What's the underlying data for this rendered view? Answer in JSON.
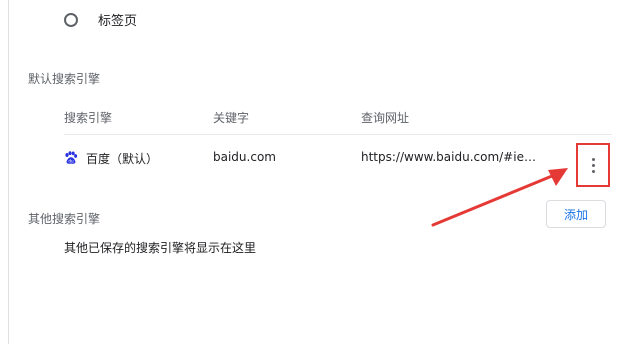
{
  "startup": {
    "radio_label": "标签页"
  },
  "default_engines": {
    "title": "默认搜索引擎",
    "headers": {
      "engine": "搜索引擎",
      "keyword": "关键字",
      "url": "查询网址"
    },
    "rows": [
      {
        "engine": "百度（默认）",
        "keyword": "baidu.com",
        "url": "https://www.baidu.com/#ie={inputEncoding}&wd=%s",
        "icon": "baidu-paw-icon"
      }
    ]
  },
  "other_engines": {
    "title": "其他搜索引擎",
    "add_label": "添加",
    "empty_text": "其他已保存的搜索引擎将显示在这里"
  },
  "colors": {
    "accent": "#1a73e8",
    "highlight": "#e53935"
  }
}
